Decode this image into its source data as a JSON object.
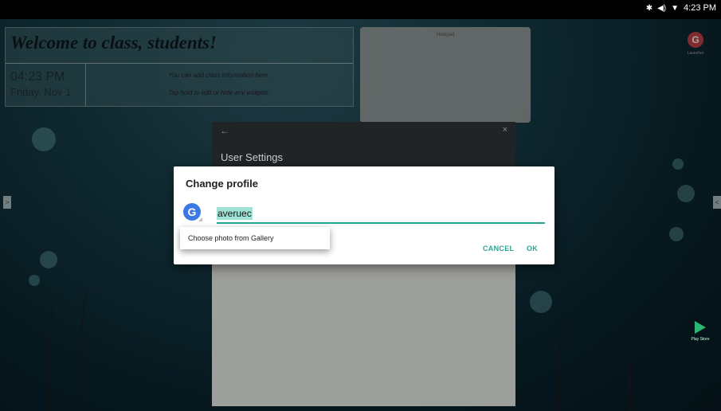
{
  "status_bar": {
    "bluetooth": "✱",
    "volume": "◀)",
    "wifi": "▼",
    "time": "4:23 PM"
  },
  "welcome": {
    "title": "Welcome to class, students!",
    "time": "04:23 PM",
    "date": "Friday, Nov 1",
    "info_line_1": "You can add class information here.",
    "info_line_2": "Tap hold to edit or hide any widgets."
  },
  "right_panel": {
    "label": "Notepad"
  },
  "settings": {
    "back_icon": "←",
    "close_icon": "×",
    "title": "User Settings"
  },
  "dialog": {
    "title": "Change profile",
    "avatar_letter": "G",
    "name_value": "averuec",
    "cancel_label": "CANCEL",
    "ok_label": "OK"
  },
  "popup": {
    "item_label": "Choose photo from Gallery"
  },
  "side_arrows": {
    "left": ">",
    "right": "<"
  },
  "dock": {
    "playstore_label": "Play Store",
    "g_letter": "G",
    "g_label": "Launcher"
  },
  "colors": {
    "accent": "#2aa592",
    "avatar": "#3b79e6"
  },
  "icons": [
    "bluetooth-icon",
    "volume-icon",
    "wifi-icon",
    "back-arrow-icon",
    "close-icon",
    "google-avatar-icon",
    "play-store-icon"
  ]
}
